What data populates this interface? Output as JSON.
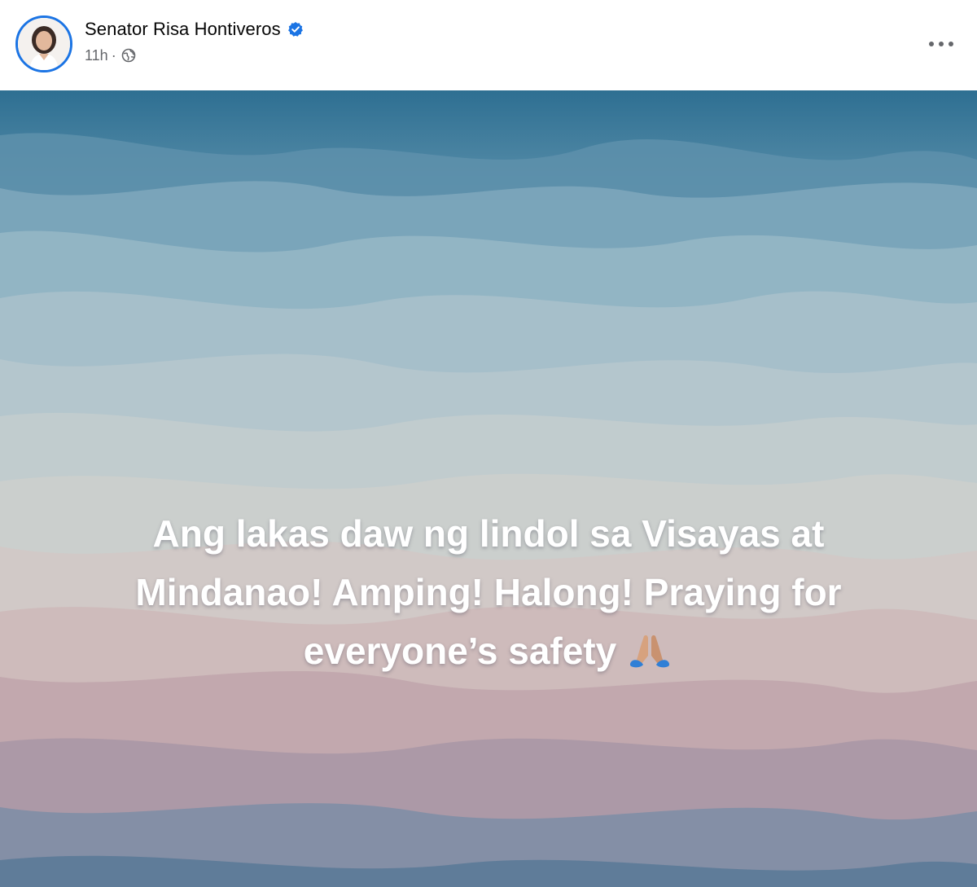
{
  "post": {
    "author": {
      "name": "Senator Risa Hontiveros",
      "verified": true
    },
    "meta": {
      "timestamp": "11h",
      "separator": "·",
      "privacy_icon": "globe-icon"
    },
    "menu_icon": "more-options-icon",
    "text_line_1": "Ang lakas daw ng lindol sa Visayas at",
    "text_line_2": "Mindanao! Amping! Halong! Praying for",
    "text_line_3": "everyone’s safety",
    "emoji_icon": "folded-hands-icon",
    "background": {
      "style": "layered pastel waves",
      "top_color": "#2e6f92",
      "mid_color": "#c9c6c4",
      "bottom_color": "#3f6a8a"
    }
  },
  "colors": {
    "accent": "#1b74e4",
    "text_primary": "#050505",
    "text_secondary": "#65676b"
  }
}
